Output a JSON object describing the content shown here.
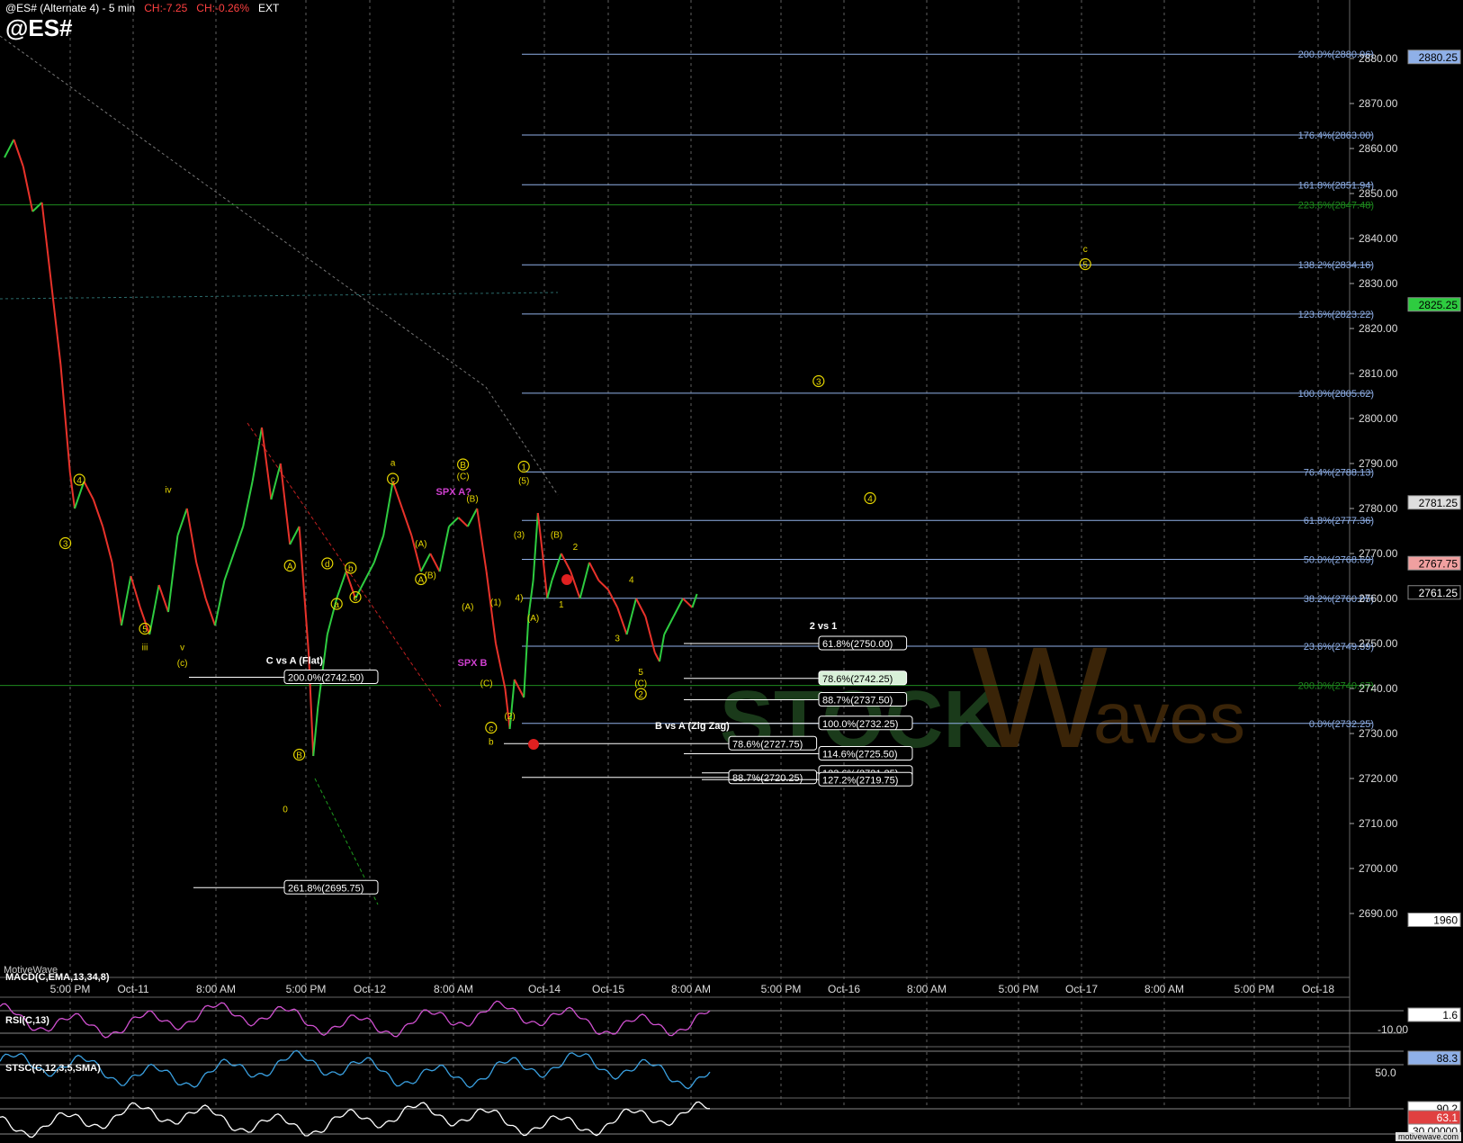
{
  "header": {
    "title": "@ES# (Alternate 4) - 5 min",
    "ch1": "CH:-7.25",
    "ch2": "CH:-0.26%",
    "session": "EXT",
    "symbol": "@ES#"
  },
  "brand": "MotiveWave",
  "footer": "motivewave.com",
  "colors": {
    "fib_blue": "#8fb0e8",
    "fib_green": "#1e8a1e",
    "up_candle": "#2ecc40",
    "down_candle": "#e8322a",
    "wave_yellow": "#e8d800",
    "wave_magenta": "#d040d0",
    "grid": "#888"
  },
  "chart_data": [
    {
      "type": "line",
      "title": "@ES# (Alternate 4) - 5 min",
      "ylim": [
        2683,
        2889
      ],
      "y_ticks": [
        2690,
        2700,
        2710,
        2720,
        2730,
        2740,
        2750,
        2760,
        2770,
        2780,
        2790,
        2800,
        2810,
        2820,
        2830,
        2840,
        2850,
        2860,
        2870,
        2880
      ],
      "x_tick_labels": [
        "5:00 PM",
        "Oct-11",
        "8:00 AM",
        "5:00 PM",
        "Oct-12",
        "8:00 AM",
        "Oct-14",
        "Oct-15",
        "8:00 AM",
        "5:00 PM",
        "Oct-16",
        "8:00 AM",
        "5:00 PM",
        "Oct-17",
        "8:00 AM",
        "5:00 PM",
        "Oct-18"
      ],
      "price_path": [
        [
          0,
          2858
        ],
        [
          2,
          2862
        ],
        [
          4,
          2856
        ],
        [
          6,
          2846
        ],
        [
          8,
          2848
        ],
        [
          10,
          2830
        ],
        [
          12,
          2812
        ],
        [
          14,
          2788
        ],
        [
          15,
          2780
        ],
        [
          17,
          2786
        ],
        [
          19,
          2782
        ],
        [
          21,
          2776
        ],
        [
          23,
          2768
        ],
        [
          25,
          2754
        ],
        [
          27,
          2765
        ],
        [
          29,
          2758
        ],
        [
          31,
          2752
        ],
        [
          33,
          2763
        ],
        [
          35,
          2757
        ],
        [
          37,
          2774
        ],
        [
          39,
          2780
        ],
        [
          41,
          2768
        ],
        [
          43,
          2760
        ],
        [
          45,
          2754
        ],
        [
          47,
          2764
        ],
        [
          49,
          2770
        ],
        [
          51,
          2776
        ],
        [
          53,
          2786
        ],
        [
          55,
          2798
        ],
        [
          57,
          2782
        ],
        [
          59,
          2790
        ],
        [
          61,
          2772
        ],
        [
          63,
          2776
        ],
        [
          65,
          2748
        ],
        [
          66,
          2725
        ],
        [
          67,
          2736
        ],
        [
          69,
          2752
        ],
        [
          71,
          2760
        ],
        [
          73,
          2766
        ],
        [
          75,
          2760
        ],
        [
          77,
          2764
        ],
        [
          79,
          2768
        ],
        [
          81,
          2774
        ],
        [
          83,
          2786
        ],
        [
          85,
          2780
        ],
        [
          87,
          2774
        ],
        [
          89,
          2766
        ],
        [
          91,
          2770
        ],
        [
          93,
          2766
        ],
        [
          95,
          2776
        ],
        [
          97,
          2778
        ],
        [
          99,
          2776
        ],
        [
          101,
          2780
        ],
        [
          103,
          2766
        ],
        [
          105,
          2750
        ],
        [
          107,
          2740
        ],
        [
          108,
          2731
        ],
        [
          109,
          2742
        ],
        [
          111,
          2738
        ],
        [
          112,
          2756
        ],
        [
          113,
          2764
        ],
        [
          114,
          2779
        ],
        [
          115,
          2770
        ],
        [
          116,
          2760
        ],
        [
          117,
          2764
        ],
        [
          119,
          2770
        ],
        [
          121,
          2766
        ],
        [
          123,
          2760
        ],
        [
          125,
          2768
        ],
        [
          127,
          2764
        ],
        [
          129,
          2762
        ],
        [
          131,
          2758
        ],
        [
          133,
          2752
        ],
        [
          135,
          2760
        ],
        [
          137,
          2756
        ],
        [
          139,
          2748
        ],
        [
          140,
          2746
        ],
        [
          141,
          2752
        ],
        [
          143,
          2756
        ],
        [
          145,
          2760
        ],
        [
          147,
          2758
        ],
        [
          148,
          2761
        ]
      ],
      "current_price": "2761.25",
      "fib_levels_blue": [
        {
          "label": "200.0%(2880.96)",
          "y": 2880.96
        },
        {
          "label": "176.4%(2863.00)",
          "y": 2863.0
        },
        {
          "label": "161.8%(2851.94)",
          "y": 2851.94
        },
        {
          "label": "138.2%(2834.16)",
          "y": 2834.16
        },
        {
          "label": "123.6%(2823.22)",
          "y": 2823.22
        },
        {
          "label": "100.0%(2805.62)",
          "y": 2805.62
        },
        {
          "label": "76.4%(2788.13)",
          "y": 2788.13
        },
        {
          "label": "61.8%(2777.36)",
          "y": 2777.36
        },
        {
          "label": "50.0%(2768.69)",
          "y": 2768.69
        },
        {
          "label": "38.2%(2760.05)",
          "y": 2760.05
        },
        {
          "label": "23.6%(2749.39)",
          "y": 2749.39
        },
        {
          "label": "0.0%(2732.25)",
          "y": 2732.25
        }
      ],
      "fib_levels_green": [
        {
          "label": "223.6%(2847.48)",
          "y": 2847.48
        },
        {
          "label": "200.0%(2740.67)",
          "y": 2740.67
        }
      ],
      "boxed_levels": [
        {
          "label": "61.8%(2750.00)",
          "y": 2750.0,
          "highlight": false
        },
        {
          "label": "78.6%(2742.25)",
          "y": 2742.25,
          "highlight": true
        },
        {
          "label": "88.7%(2737.50)",
          "y": 2737.5,
          "highlight": false
        },
        {
          "label": "100.0%(2732.25)",
          "y": 2732.25,
          "highlight": false
        },
        {
          "label": "78.6%(2727.75)",
          "y": 2727.75,
          "highlight": false
        },
        {
          "label": "114.6%(2725.50)",
          "y": 2725.5,
          "highlight": false
        },
        {
          "label": "123.6%(2721.25)",
          "y": 2721.25,
          "highlight": false
        },
        {
          "label": "88.7%(2720.25)",
          "y": 2720.25,
          "highlight": false
        },
        {
          "label": "127.2%(2719.75)",
          "y": 2719.75,
          "highlight": false
        },
        {
          "label": "200.0%(2742.50)",
          "y": 2742.5,
          "highlight": false
        },
        {
          "label": "261.8%(2695.75)",
          "y": 2695.75,
          "highlight": false
        }
      ],
      "right_badges": [
        {
          "label": "2880.25",
          "y": 2880.25,
          "bg": "#8fb0e8",
          "fg": "#000"
        },
        {
          "label": "2825.25",
          "y": 2825.25,
          "bg": "#2ecc40",
          "fg": "#000"
        },
        {
          "label": "2781.25",
          "y": 2781.25,
          "bg": "#ddd",
          "fg": "#000"
        },
        {
          "label": "2767.75",
          "y": 2767.75,
          "bg": "#f0a0a0",
          "fg": "#000"
        },
        {
          "label": "2761.25",
          "y": 2761.25,
          "bg": "#000",
          "fg": "#fff"
        },
        {
          "label": "1960",
          "y": 2688.5,
          "bg": "#fff",
          "fg": "#000"
        }
      ],
      "annotations": [
        {
          "text": "C vs A (Flat)",
          "x": 62,
          "y": 2745.5,
          "color": "#fff"
        },
        {
          "text": "2 vs 1",
          "x": 175,
          "y": 2753.2,
          "color": "#fff"
        },
        {
          "text": "B vs A (Zig Zag)",
          "x": 147,
          "y": 2731.0,
          "color": "#fff"
        },
        {
          "text": "SPX A?",
          "x": 96,
          "y": 2783.0,
          "color": "#d040d0"
        },
        {
          "text": "SPX B",
          "x": 100,
          "y": 2745.0,
          "color": "#d040d0"
        }
      ],
      "wave_labels": [
        {
          "t": "4",
          "x": 16,
          "y": 2785.6,
          "c": true
        },
        {
          "t": "3",
          "x": 13,
          "y": 2771.5,
          "c": true
        },
        {
          "t": "iv",
          "x": 35,
          "y": 2783.5,
          "c": false
        },
        {
          "t": "5",
          "x": 30,
          "y": 2752.5,
          "c": true
        },
        {
          "t": "iii",
          "x": 30,
          "y": 2748.5,
          "c": false
        },
        {
          "t": "v",
          "x": 38,
          "y": 2748.5,
          "c": false
        },
        {
          "t": "(c)",
          "x": 38,
          "y": 2745.0,
          "c": false
        },
        {
          "t": "A",
          "x": 61,
          "y": 2766.5,
          "c": true
        },
        {
          "t": "B",
          "x": 63,
          "y": 2724.5,
          "c": true
        },
        {
          "t": "0",
          "x": 60,
          "y": 2712.5,
          "c": false
        },
        {
          "t": "d",
          "x": 69,
          "y": 2767.0,
          "c": true
        },
        {
          "t": "b",
          "x": 74,
          "y": 2766.0,
          "c": true
        },
        {
          "t": "a",
          "x": 71,
          "y": 2758.0,
          "c": true
        },
        {
          "t": "c",
          "x": 75,
          "y": 2759.5,
          "c": true
        },
        {
          "t": "a",
          "x": 83,
          "y": 2789.5,
          "c": false
        },
        {
          "t": "c",
          "x": 83,
          "y": 2785.8,
          "c": true
        },
        {
          "t": "(A)",
          "x": 89,
          "y": 2771.5,
          "c": false
        },
        {
          "t": "A",
          "x": 89,
          "y": 2763.5,
          "c": true
        },
        {
          "t": "(B)",
          "x": 91,
          "y": 2764.5,
          "c": false
        },
        {
          "t": "B",
          "x": 98,
          "y": 2789.0,
          "c": true
        },
        {
          "t": "(C)",
          "x": 98,
          "y": 2786.5,
          "c": false
        },
        {
          "t": "(B)",
          "x": 100,
          "y": 2781.5,
          "c": false
        },
        {
          "t": "(A)",
          "x": 99,
          "y": 2757.5,
          "c": false
        },
        {
          "t": "(1)",
          "x": 105,
          "y": 2758.5,
          "c": false
        },
        {
          "t": "(C)",
          "x": 103,
          "y": 2740.5,
          "c": false
        },
        {
          "t": "c",
          "x": 104,
          "y": 2730.5,
          "c": true
        },
        {
          "t": "(2)",
          "x": 108,
          "y": 2733.2,
          "c": false
        },
        {
          "t": "1",
          "x": 111,
          "y": 2788.5,
          "c": true
        },
        {
          "t": "(5)",
          "x": 111,
          "y": 2785.5,
          "c": false
        },
        {
          "t": "(3)",
          "x": 110,
          "y": 2773.5,
          "c": false
        },
        {
          "t": "4)",
          "x": 110,
          "y": 2759.5,
          "c": false
        },
        {
          "t": "(A)",
          "x": 113,
          "y": 2755.0,
          "c": false
        },
        {
          "t": "(B)",
          "x": 118,
          "y": 2773.5,
          "c": false
        },
        {
          "t": "2",
          "x": 122,
          "y": 2770.8,
          "c": false
        },
        {
          "t": "1",
          "x": 119,
          "y": 2758.0,
          "c": false
        },
        {
          "t": "4",
          "x": 134,
          "y": 2763.5,
          "c": false
        },
        {
          "t": "3",
          "x": 131,
          "y": 2750.5,
          "c": false
        },
        {
          "t": "5",
          "x": 136,
          "y": 2743.0,
          "c": false
        },
        {
          "t": "(C)",
          "x": 136,
          "y": 2740.5,
          "c": false
        },
        {
          "t": "2",
          "x": 136,
          "y": 2738.0,
          "c": true
        },
        {
          "t": "b",
          "x": 104,
          "y": 2727.5,
          "c": false
        },
        {
          "t": "3",
          "x": 174,
          "y": 2807.5,
          "c": true
        },
        {
          "t": "4",
          "x": 185,
          "y": 2781.5,
          "c": true
        },
        {
          "t": "c",
          "x": 231,
          "y": 2837.0,
          "c": false
        },
        {
          "t": "5",
          "x": 231,
          "y": 2833.5,
          "c": true
        }
      ]
    },
    {
      "type": "line",
      "title": "MACD(C,EMA,13,34,8)",
      "ylim": [
        -13,
        5
      ],
      "y_ticks": [
        -10
      ],
      "value": "1.6"
    },
    {
      "type": "line",
      "title": "RSI(C,13)",
      "ylim": [
        35,
        95
      ],
      "y_ticks": [
        50
      ],
      "value": "88.3"
    },
    {
      "type": "line",
      "title": "STSC(C,12,3,5,SMA)",
      "ylim": [
        0,
        100
      ],
      "y_ticks": [
        30
      ],
      "values": [
        "90.2",
        "63.1",
        "30.00000"
      ]
    }
  ],
  "panes": {
    "macd_label": "MACD(C,EMA,13,34,8)",
    "rsi_label": "RSI(C,13)",
    "stsc_label": "STSC(C,12,3,5,SMA)",
    "macd_badge": "1.6",
    "macd_tick": "-10.00",
    "rsi_badge": "88.3",
    "rsi_tick": "50.0",
    "stsc_badge1": "90.2",
    "stsc_badge2": "63.1",
    "stsc_tick": "30.00000",
    "y_axis_ticks_text": [
      "2690.00",
      "2700.00",
      "2710.00",
      "2720.00",
      "2730.00",
      "2740.00",
      "2750.00",
      "2760.00",
      "2770.00",
      "2780.00",
      "2790.00",
      "2800.00",
      "2810.00",
      "2820.00",
      "2830.00",
      "2840.00",
      "2850.00",
      "2860.00",
      "2870.00",
      "2880.00"
    ],
    "watermark": "STOCK Waves"
  }
}
